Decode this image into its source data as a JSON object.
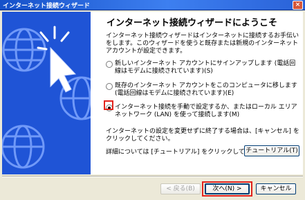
{
  "window": {
    "title": "インターネット接続ウィザード",
    "close_label": "×"
  },
  "page": {
    "heading": "インターネット接続ウィザードにようこそ",
    "intro": "インターネット接続ウィザードはインターネットに接続するお手伝いをします。このウィザードを使うと既存または新規のインターネット アカウントが設定できます。",
    "options": [
      {
        "label": "新しいインターネット アカウントにサインアップします (電話回線はモデムに接続されています)(S)",
        "selected": false
      },
      {
        "label": "既存のインターネット アカウントをこのコンピュータに移します (電話回線はモデムに接続されています)(E)",
        "selected": false
      },
      {
        "label": "インターネット接続を手動で設定するか、またはローカル エリア ネットワーク (LAN) を使って接続します(M)",
        "selected": true
      }
    ],
    "note": "インターネットの設定を変更せずに終了する場合は、[キャンセル] をクリックしてください。",
    "tutorial_text": "詳細については [チュートリアル] をクリックしてください。",
    "tutorial_button": "チュートリアル(T)"
  },
  "buttons": {
    "back": "< 戻る(B)",
    "next": "次へ(N) >",
    "cancel": "キャンセル"
  },
  "colors": {
    "left_panel": "#1f54d6",
    "highlight": "#e3231c"
  }
}
